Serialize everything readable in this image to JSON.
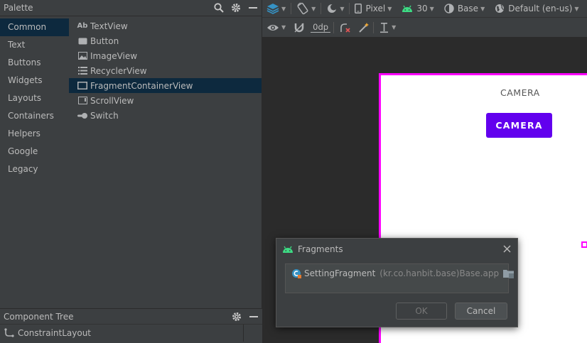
{
  "palette": {
    "title": "Palette",
    "categories": [
      "Common",
      "Text",
      "Buttons",
      "Widgets",
      "Layouts",
      "Containers",
      "Helpers",
      "Google",
      "Legacy"
    ],
    "selected_category": "Common",
    "widgets": [
      {
        "label": "TextView",
        "icon": "Ab"
      },
      {
        "label": "Button",
        "icon": "button-icon"
      },
      {
        "label": "ImageView",
        "icon": "image-icon"
      },
      {
        "label": "RecyclerView",
        "icon": "list-icon"
      },
      {
        "label": "FragmentContainerView",
        "icon": "fragment-icon"
      },
      {
        "label": "ScrollView",
        "icon": "scroll-icon"
      },
      {
        "label": "Switch",
        "icon": "switch-icon"
      }
    ]
  },
  "component_tree": {
    "title": "Component Tree",
    "root": "ConstraintLayout"
  },
  "toolbar": {
    "device": "Pixel",
    "api": "30",
    "theme": "Base",
    "locale": "Default (en-us)",
    "margin": "0dp"
  },
  "design": {
    "camera_text": "CAMERA",
    "camera_button": "CAMERA",
    "button_color": "#6200ee",
    "selection_color": "#ff00ff"
  },
  "dialog": {
    "title": "Fragments",
    "item_name": "SettingFragment",
    "item_package": "(kr.co.hanbit.base)",
    "item_module": "Base.app",
    "ok_label": "OK",
    "cancel_label": "Cancel"
  }
}
